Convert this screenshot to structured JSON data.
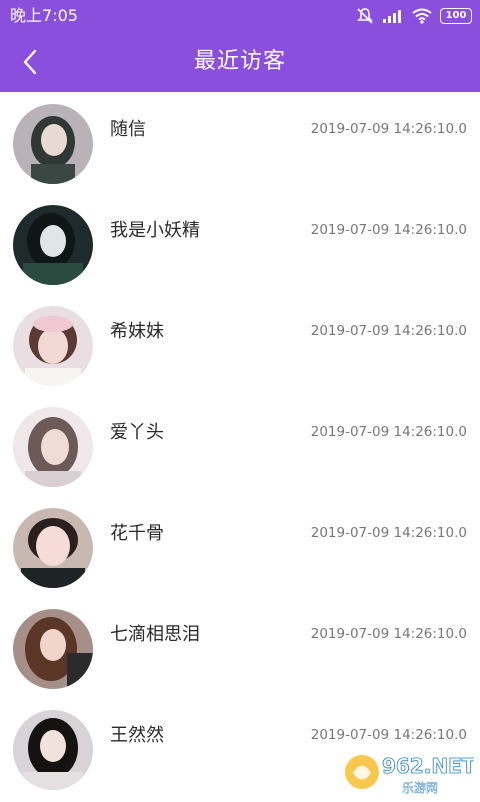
{
  "status_bar": {
    "time": "晚上7:05",
    "battery": "100"
  },
  "nav": {
    "title": "最近访客",
    "back_icon": "chevron-left-icon"
  },
  "visitors": [
    {
      "name": "随信",
      "time": "2019-07-09 14:26:10.0"
    },
    {
      "name": "我是小妖精",
      "time": "2019-07-09 14:26:10.0"
    },
    {
      "name": "希妹妹",
      "time": "2019-07-09 14:26:10.0"
    },
    {
      "name": "爱丫头",
      "time": "2019-07-09 14:26:10.0"
    },
    {
      "name": "花千骨",
      "time": "2019-07-09 14:26:10.0"
    },
    {
      "name": "七滴相思泪",
      "time": "2019-07-09 14:26:10.0"
    },
    {
      "name": "王然然",
      "time": "2019-07-09 14:26:10.0"
    }
  ],
  "watermark": {
    "brand": "962.NET",
    "subtitle": "乐游网"
  },
  "colors": {
    "accent": "#8a4fdc",
    "name_text": "#2a2a2a",
    "time_text": "#777777"
  }
}
